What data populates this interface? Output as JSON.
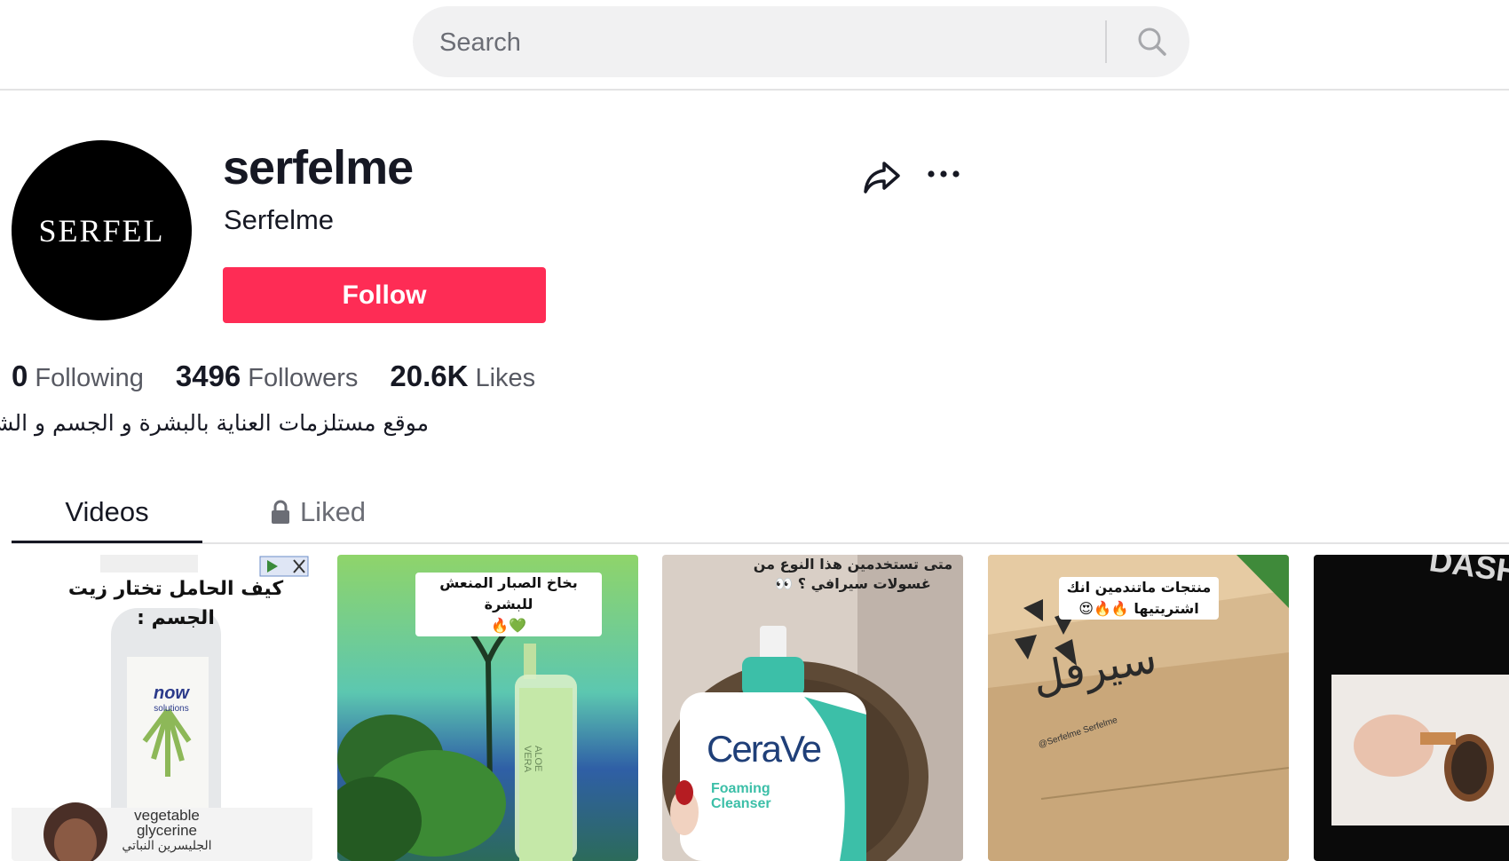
{
  "search": {
    "placeholder": "Search",
    "icon": "search-icon"
  },
  "profile": {
    "avatar_text": "SERFEL",
    "username": "serfelme",
    "nickname": "Serfelme",
    "follow_label": "Follow",
    "share_icon": "share-icon",
    "more_icon": "more-icon",
    "stats": {
      "following_count": "0",
      "following_label": "Following",
      "followers_count": "3496",
      "followers_label": "Followers",
      "likes_count": "20.6K",
      "likes_label": "Likes"
    },
    "bio": "موقع مستلزمات العناية بالبشرة و الجسم و الشعر",
    "bio_emoji": "🖤",
    "accent_color": "#fe2c55"
  },
  "tabs": {
    "videos": "Videos",
    "liked": "Liked",
    "liked_icon": "lock-icon"
  },
  "videos": [
    {
      "caption_line1": "كيف الحامل تختار زيت",
      "caption_line2": "الجسم :",
      "label_brand": "now",
      "label_sub": "solutions",
      "label_line1": "vegetable",
      "label_line2": "glycerine",
      "label_line3": "الجليسرين النباتي"
    },
    {
      "caption_line1": "بخاخ الصبار المنعش للبشرة",
      "caption_line2": "💚🔥",
      "label_text": "ALOE VERA"
    },
    {
      "caption_line1": "متى تستخدمين هذا النوع من",
      "caption_line2": "غسولات سيرافي ؟ 👀",
      "label_brand": "CeraVe",
      "label_line1": "Foaming",
      "label_line2": "Cleanser"
    },
    {
      "caption_line1": "منتجات ماتندمين انك",
      "caption_line2": "اشتريتيها 🔥🔥😍",
      "box_text": "سيرفل",
      "box_handles": "@Serfelme  Serfelme"
    },
    {
      "label_text": "DASH"
    }
  ]
}
